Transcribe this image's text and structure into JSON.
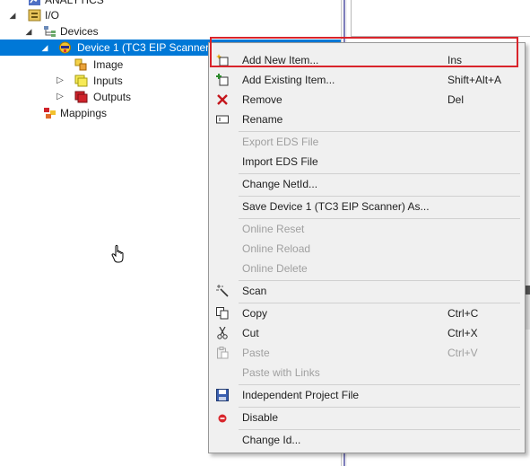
{
  "tree": {
    "analytics_label": "ANALYTICS",
    "io_label": "I/O",
    "devices_label": "Devices",
    "device1_label": "Device 1 (TC3 EIP Scanner)",
    "image_label": "Image",
    "inputs_label": "Inputs",
    "outputs_label": "Outputs",
    "mappings_label": "Mappings"
  },
  "menu": {
    "add_new_item": {
      "label": "Add New Item...",
      "shortcut": "Ins"
    },
    "add_existing_item": {
      "label": "Add Existing Item...",
      "shortcut": "Shift+Alt+A"
    },
    "remove": {
      "label": "Remove",
      "shortcut": "Del"
    },
    "rename": {
      "label": "Rename"
    },
    "export_eds": {
      "label": "Export EDS File"
    },
    "import_eds": {
      "label": "Import EDS File"
    },
    "change_netid": {
      "label": "Change NetId..."
    },
    "save_device_as": {
      "label": "Save Device 1 (TC3 EIP Scanner) As..."
    },
    "online_reset": {
      "label": "Online Reset"
    },
    "online_reload": {
      "label": "Online Reload"
    },
    "online_delete": {
      "label": "Online Delete"
    },
    "scan": {
      "label": "Scan"
    },
    "copy": {
      "label": "Copy",
      "shortcut": "Ctrl+C"
    },
    "cut": {
      "label": "Cut",
      "shortcut": "Ctrl+X"
    },
    "paste": {
      "label": "Paste",
      "shortcut": "Ctrl+V"
    },
    "paste_with_links": {
      "label": "Paste with Links"
    },
    "independent_project_file": {
      "label": "Independent Project File"
    },
    "disable": {
      "label": "Disable"
    },
    "change_id": {
      "label": "Change Id..."
    }
  },
  "icons": {
    "add_new": "add-new-item-icon",
    "add_existing": "add-existing-item-icon",
    "remove": "remove-x-icon",
    "rename": "rename-icon",
    "scan": "magic-wand-icon",
    "copy": "copy-icon",
    "cut": "scissors-icon",
    "paste": "clipboard-icon",
    "project_file": "floppy-disk-icon",
    "disable": "disable-icon"
  },
  "colors": {
    "selection": "#0078d7",
    "highlight_frame": "#d9242b",
    "disabled_text": "#a0a0a0"
  }
}
